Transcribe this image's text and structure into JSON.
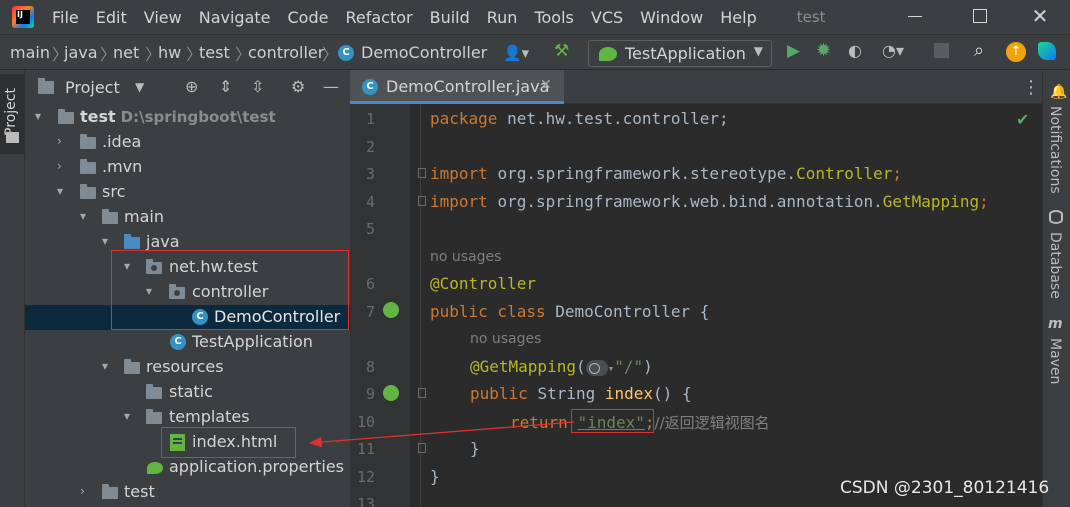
{
  "menubar": {
    "items": [
      "File",
      "Edit",
      "View",
      "Navigate",
      "Code",
      "Refactor",
      "Build",
      "Run",
      "Tools",
      "VCS",
      "Window",
      "Help"
    ],
    "window_title": "test"
  },
  "breadcrumb": [
    "main",
    "java",
    "net",
    "hw",
    "test",
    "controller",
    "DemoController"
  ],
  "run_config": "TestApplication",
  "project_panel": {
    "title": "Project",
    "tree": [
      {
        "label": "test",
        "path": "D:\\springboot\\test"
      },
      {
        "label": ".idea"
      },
      {
        "label": ".mvn"
      },
      {
        "label": "src"
      },
      {
        "label": "main"
      },
      {
        "label": "java"
      },
      {
        "label": "net.hw.test"
      },
      {
        "label": "controller"
      },
      {
        "label": "DemoController"
      },
      {
        "label": "TestApplication"
      },
      {
        "label": "resources"
      },
      {
        "label": "static"
      },
      {
        "label": "templates"
      },
      {
        "label": "index.html"
      },
      {
        "label": "application.properties"
      },
      {
        "label": "test"
      }
    ]
  },
  "left_strip": {
    "project_tab": "Project"
  },
  "editor": {
    "tab_label": "DemoController.java",
    "line_numbers": [
      "1",
      "2",
      "3",
      "4",
      "5",
      "6",
      "7",
      "8",
      "9",
      "10",
      "11",
      "12",
      "13"
    ],
    "usage_hint": "no usages",
    "code": {
      "l1_kw": "package ",
      "l1_rest": "net.hw.test.controller;",
      "l3_kw": "import ",
      "l3_pkg": "org.springframework.stereotype.",
      "l3_cls": "Controller",
      "l3_end": ";",
      "l4_kw": "import ",
      "l4_pkg": "org.springframework.web.bind.annotation.",
      "l4_cls": "GetMapping",
      "l4_end": ";",
      "l6_ann": "@Controller",
      "l7_kw": "public class ",
      "l7_name": "DemoController {",
      "l8_ann": "@GetMapping",
      "l8_open": "(",
      "l8_str": "\"/\"",
      "l8_close": ")",
      "l9_kw": "public ",
      "l9_type": "String ",
      "l9_fn": "index",
      "l9_rest": "() {",
      "l10_kw": "return ",
      "l10_str": "\"index\"",
      "l10_semi": ";",
      "l10_cmt": "//返回逻辑视图名",
      "l11": "}",
      "l12": "}"
    }
  },
  "right_strip": {
    "tabs": [
      "Notifications",
      "Database",
      "Maven"
    ]
  },
  "watermark": "CSDN @2301_80121416",
  "colors": {
    "accent": "#4a88c7",
    "highlight_box": "#e0302f",
    "keyword": "#cc7832",
    "annotation": "#bbb529"
  }
}
